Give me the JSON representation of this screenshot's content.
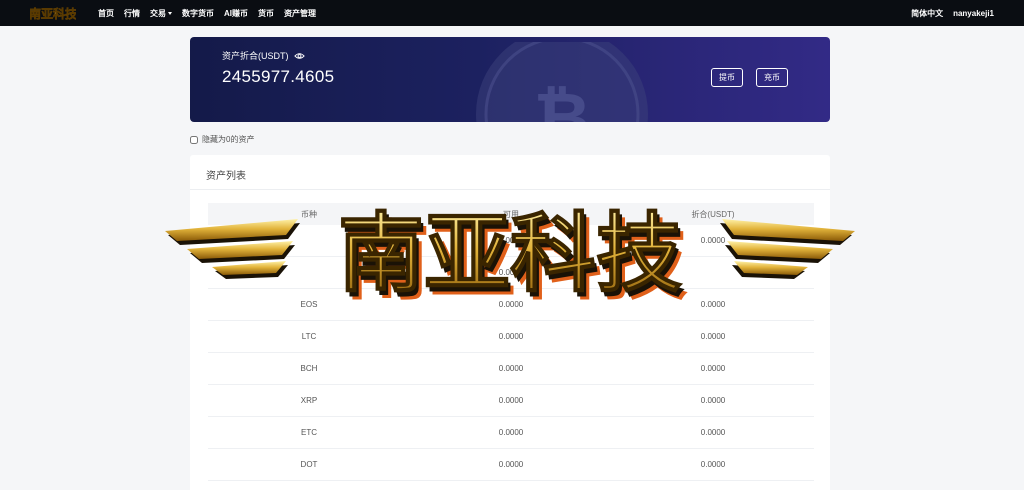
{
  "header": {
    "logo_text": "南亚科技",
    "nav": [
      {
        "label": "首页"
      },
      {
        "label": "行情"
      },
      {
        "label": "交易",
        "has_dropdown": true
      },
      {
        "label": "数字货币"
      },
      {
        "label": "AI赚币"
      },
      {
        "label": "货币"
      },
      {
        "label": "资产管理"
      }
    ],
    "language": "简体中文",
    "username": "nanyakeji1"
  },
  "balance": {
    "label": "资产折合(USDT)",
    "value": "2455977.4605",
    "icon": "eye-icon",
    "withdraw_label": "提币",
    "deposit_label": "充币"
  },
  "filter": {
    "hide_zero_label": "隐藏为0的资产",
    "checked": false
  },
  "assets": {
    "title": "资产列表",
    "columns": [
      "币种",
      "可用",
      "折合(USDT)"
    ],
    "rows": [
      {
        "coin": "",
        "available": "0.0000",
        "usdt": "0.0000"
      },
      {
        "coin": "",
        "available": "0.0000",
        "usdt": ""
      },
      {
        "coin": "EOS",
        "available": "0.0000",
        "usdt": "0.0000"
      },
      {
        "coin": "LTC",
        "available": "0.0000",
        "usdt": "0.0000"
      },
      {
        "coin": "BCH",
        "available": "0.0000",
        "usdt": "0.0000"
      },
      {
        "coin": "XRP",
        "available": "0.0000",
        "usdt": "0.0000"
      },
      {
        "coin": "ETC",
        "available": "0.0000",
        "usdt": "0.0000"
      },
      {
        "coin": "DOT",
        "available": "0.0000",
        "usdt": "0.0000"
      }
    ]
  },
  "watermark": {
    "text": "南亚科技"
  },
  "colors": {
    "topbar": "#0a0d12",
    "banner_start": "#141a49",
    "banner_end": "#322a86",
    "gold": "#d9a520"
  }
}
